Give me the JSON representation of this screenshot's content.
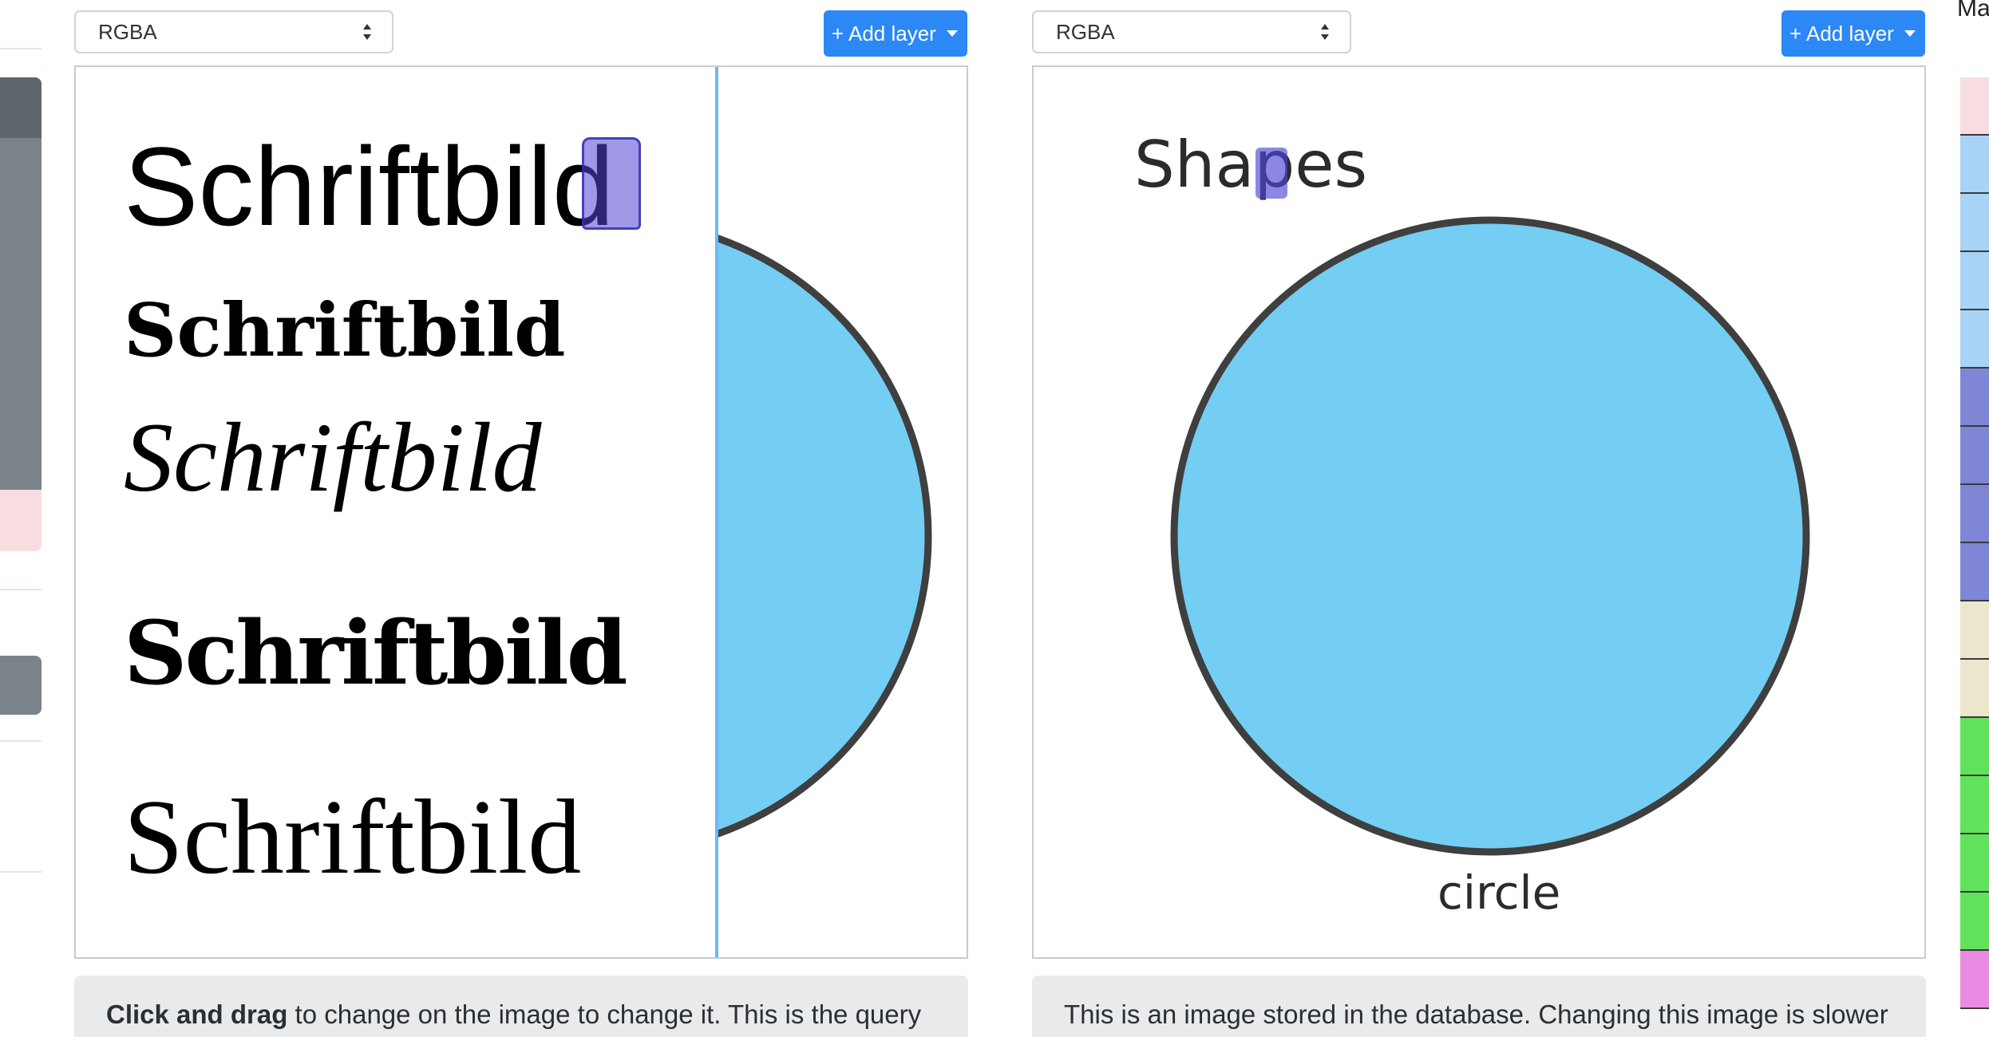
{
  "left_panel": {
    "mode_select": {
      "value": "RGBA"
    },
    "add_layer_label": "+ Add layer",
    "samples": [
      "Schriftbild",
      "Schriftbild",
      "Schriftbild",
      "Schriftbild",
      "Schriftbild"
    ],
    "note": {
      "bold": "Click and drag",
      "text": " to change on the image to change it. This is the query"
    }
  },
  "right_panel": {
    "mode_select": {
      "value": "RGBA"
    },
    "add_layer_label": "+ Add layer",
    "image_title": "Shapes",
    "image_caption": "circle",
    "note": {
      "text": "This is an image stored in the database. Changing this image is slower"
    }
  },
  "edge_text": "Ma",
  "colors": {
    "accent": "#2b88f5",
    "circle_fill": "#74cdf2",
    "circle_stroke": "#3f3f3f",
    "highlight": "#5046d6",
    "strip": [
      "#f7dde1",
      "#a9d3f6",
      "#a9d3f6",
      "#a9d3f6",
      "#a9d3f6",
      "#7f86d6",
      "#7f86d6",
      "#7f86d6",
      "#7f86d6",
      "#ece6cf",
      "#ece6cf",
      "#62e25c",
      "#62e25c",
      "#62e25c",
      "#62e25c",
      "#e98ae3"
    ]
  },
  "icons": [
    "select-arrows-icon",
    "caret-down-icon"
  ]
}
